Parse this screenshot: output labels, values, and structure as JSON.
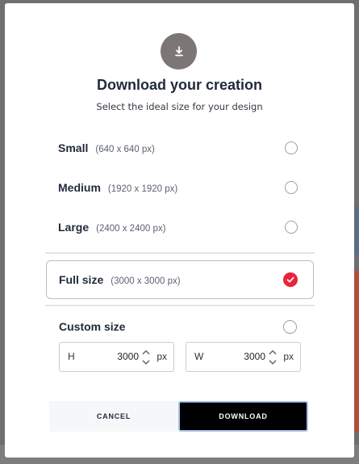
{
  "dialog": {
    "title": "Download your creation",
    "subtitle": "Select the ideal size for your design",
    "icon": "download-icon"
  },
  "options": [
    {
      "name": "Small",
      "dims": "(640 x 640 px)",
      "selected": false
    },
    {
      "name": "Medium",
      "dims": "(1920 x 1920 px)",
      "selected": false
    },
    {
      "name": "Large",
      "dims": "(2400 x 2400 px)",
      "selected": false
    },
    {
      "name": "Full size",
      "dims": "(3000 x 3000 px)",
      "selected": true
    }
  ],
  "custom": {
    "name": "Custom size",
    "selected": false,
    "height": {
      "label": "H",
      "value": "3000",
      "unit": "px"
    },
    "width": {
      "label": "W",
      "value": "3000",
      "unit": "px"
    }
  },
  "buttons": {
    "cancel": "CANCEL",
    "download": "DOWNLOAD"
  },
  "colors": {
    "accent": "#e8243a",
    "primary_button": "#000000",
    "focus_ring": "#aac2e6"
  }
}
